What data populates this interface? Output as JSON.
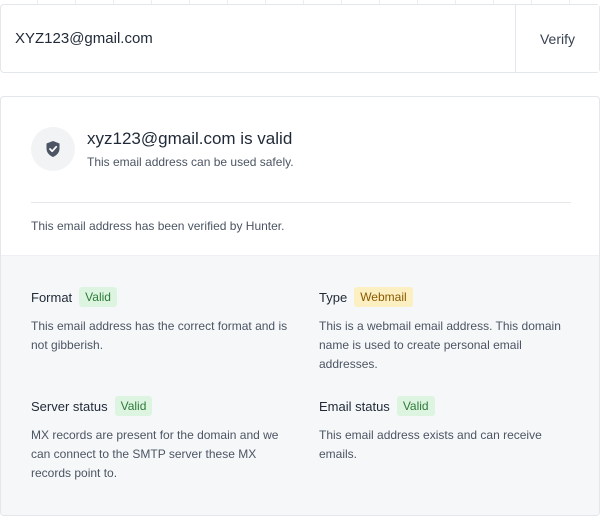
{
  "search": {
    "value": "XYZ123@gmail.com",
    "verify_label": "Verify"
  },
  "result": {
    "title": "xyz123@gmail.com is valid",
    "subtitle": "This email address can be used safely.",
    "verified_by": "This email address has been verified by Hunter.",
    "icon": "shield-check-icon"
  },
  "details": [
    {
      "label": "Format",
      "badge": "Valid",
      "description": "This email address has the correct format and is not gibberish."
    },
    {
      "label": "Type",
      "badge": "Webmail",
      "description": "This is a webmail email address. This domain name is used to create personal email addresses."
    },
    {
      "label": "Server status",
      "badge": "Valid",
      "description": "MX records are present for the domain and we can connect to the SMTP server these MX records point to."
    },
    {
      "label": "Email status",
      "badge": "Valid",
      "description": "This email address exists and can receive emails."
    }
  ],
  "colors": {
    "valid_bg": "#ddf5e0",
    "valid_text": "#2f7a3a",
    "webmail_bg": "#fcefc2",
    "webmail_text": "#8a5a00",
    "panel_bg": "#f6f7f9"
  }
}
